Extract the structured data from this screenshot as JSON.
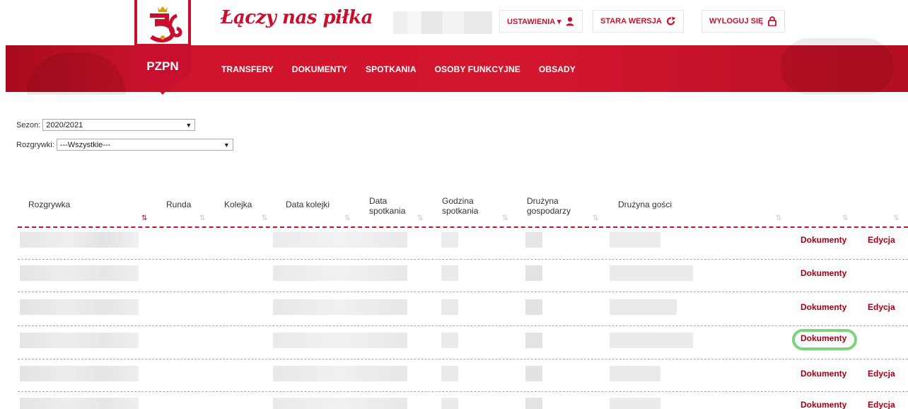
{
  "brand": {
    "slogan": "Łączy nas piłka",
    "logo_text": "PZPN",
    "red": "#c8102e"
  },
  "top_buttons": [
    {
      "label": "USTAWIENIA ▾",
      "icon": "user-icon"
    },
    {
      "label": "STARA WERSJA",
      "icon": "external-link-icon"
    },
    {
      "label": "WYLOGUJ SIĘ",
      "icon": "lock-icon"
    }
  ],
  "nav": [
    "TRANSFERY",
    "DOKUMENTY",
    "SPOTKANIA",
    "OSOBY FUNKCYJNE",
    "OBSADY"
  ],
  "filters": {
    "season": {
      "label": "Sezon:",
      "value": "2020/2021"
    },
    "competition": {
      "label": "Rozgrywki:",
      "value": "---Wszystkie---"
    }
  },
  "table": {
    "headers": [
      "Rozgrywka",
      "Runda",
      "Kolejka",
      "Data kolejki",
      "Data spotkania",
      "Godzina spotkania",
      "Drużyna gospodarzy",
      "Drużyna gości"
    ],
    "rows": [
      {
        "doc": "Dokumenty",
        "edit": "Edycja"
      },
      {
        "doc": "Dokumenty",
        "edit": ""
      },
      {
        "doc": "Dokumenty",
        "edit": "Edycja"
      },
      {
        "doc": "Dokumenty",
        "edit": ""
      },
      {
        "doc": "Dokumenty",
        "edit": "Edycja"
      },
      {
        "doc": "Dokumenty",
        "edit": "Edycja"
      }
    ]
  }
}
